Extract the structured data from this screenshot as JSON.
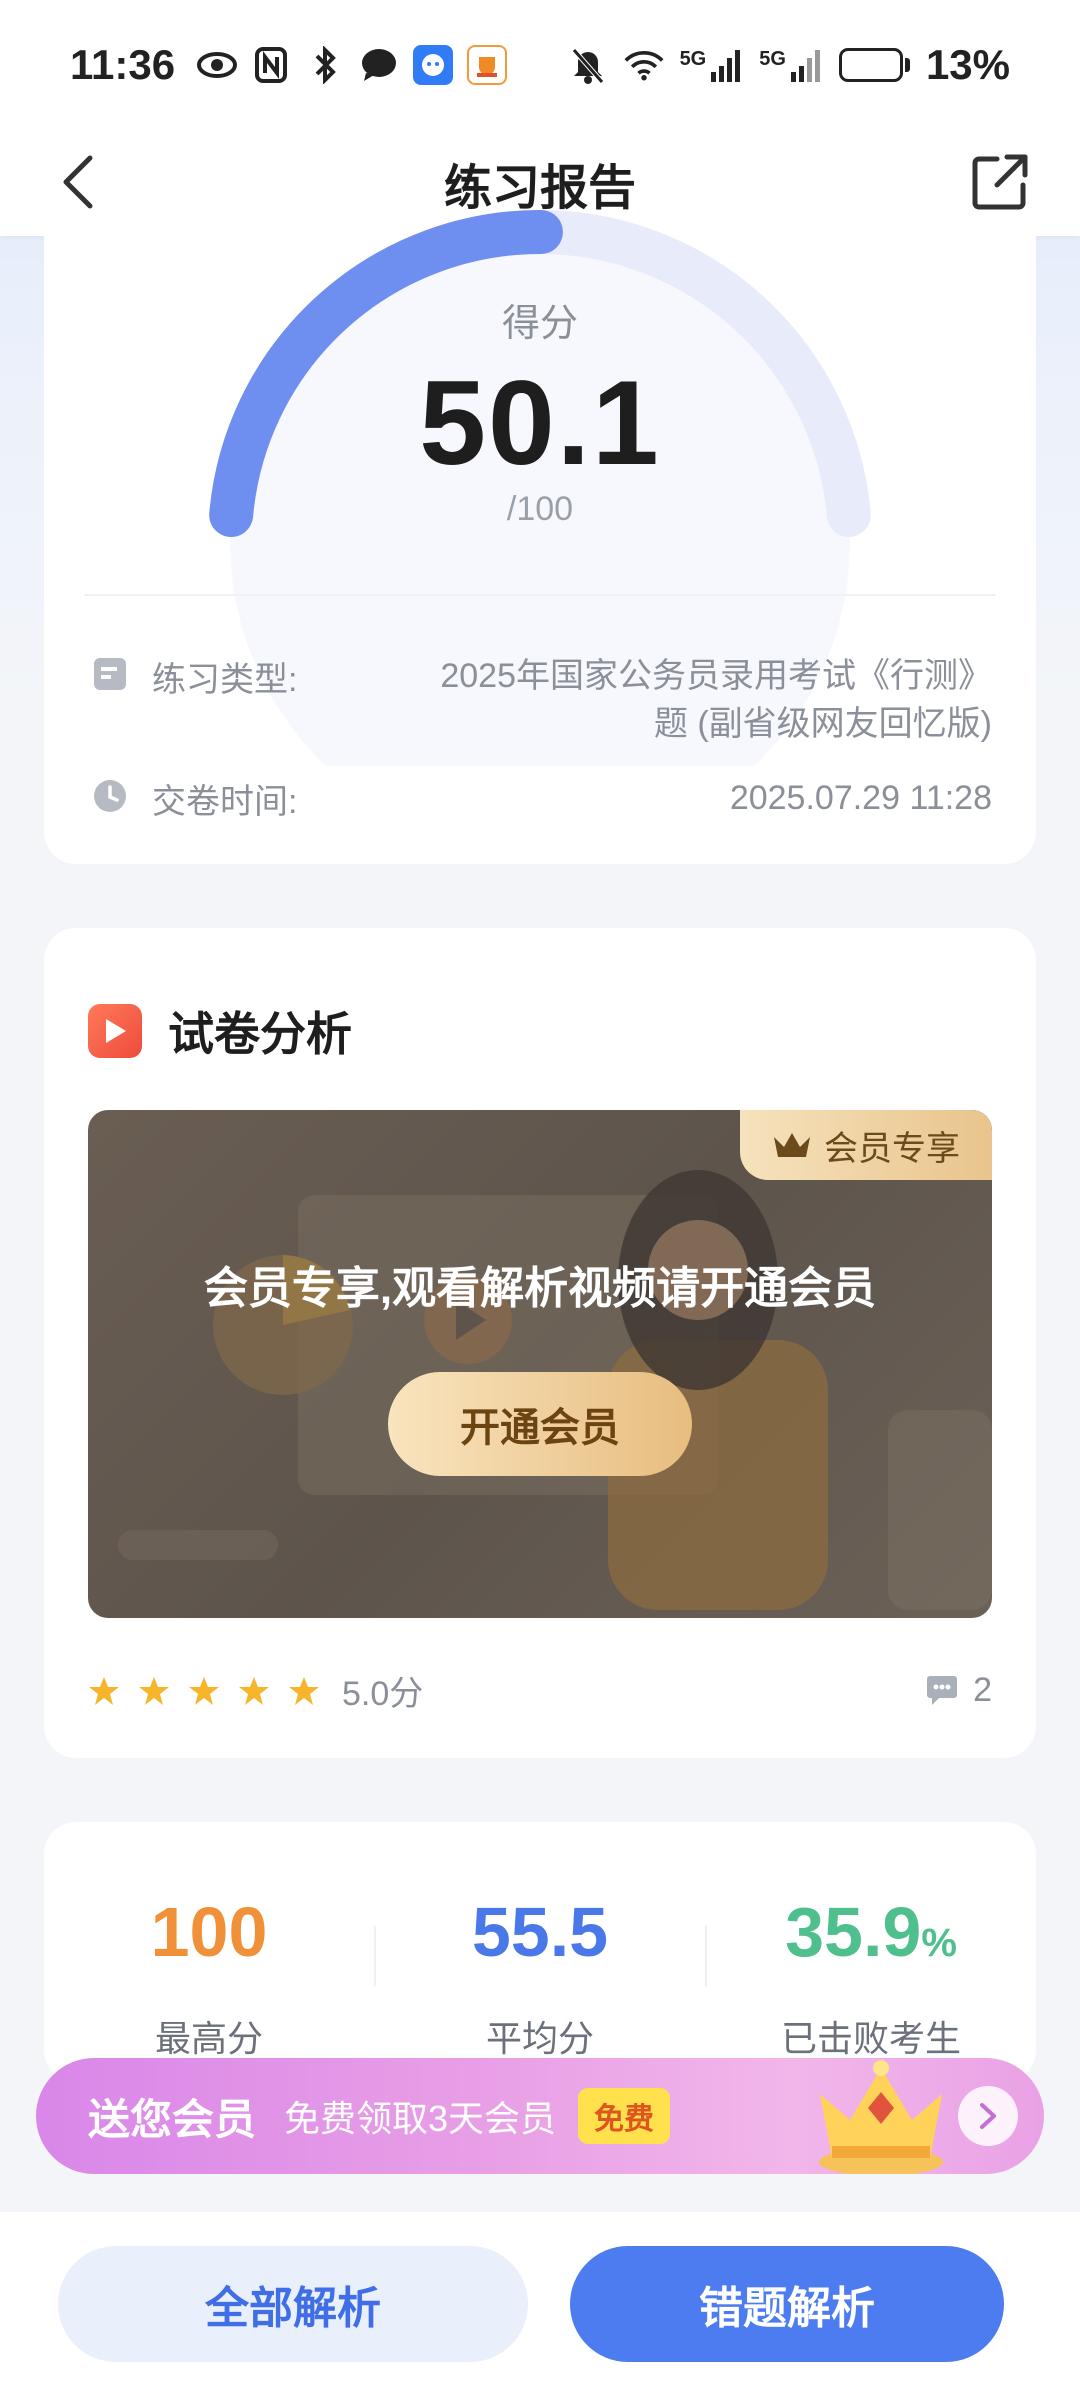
{
  "status_bar": {
    "time": "11:36",
    "battery": "13%",
    "battery_level": 0.13,
    "network_1": "5G",
    "network_2": "5G"
  },
  "nav": {
    "title": "练习报告"
  },
  "score": {
    "label": "得分",
    "value": "50.1",
    "total": "/100",
    "fraction": 0.501,
    "gauge_color": "#6f8ff0"
  },
  "info": {
    "type_label": "练习类型:",
    "type_value_line1": "2025年国家公务员录用考试《行测》",
    "type_value_line2": "题 (副省级网友回忆版)",
    "time_label": "交卷时间:",
    "time_value": "2025.07.29 11:28"
  },
  "analysis": {
    "title": "试卷分析",
    "member_tag": "会员专享",
    "video_text": "会员专享,观看解析视频请开通会员",
    "open_button": "开通会员",
    "rating_text": "5.0分",
    "stars": 5,
    "comment_count": "2"
  },
  "stats": {
    "max_value": "100",
    "max_label": "最高分",
    "avg_value": "55.5",
    "avg_label": "平均分",
    "beat_value": "35.9",
    "beat_unit": "%",
    "beat_label": "已击败考生",
    "max_color": "#f0913a",
    "avg_color": "#4a78e8",
    "beat_color": "#4fc08d"
  },
  "promo": {
    "title": "送您会员",
    "subtitle": "免费领取3天会员",
    "badge": "免费"
  },
  "bottom": {
    "all_button": "全部解析",
    "wrong_button": "错题解析"
  }
}
